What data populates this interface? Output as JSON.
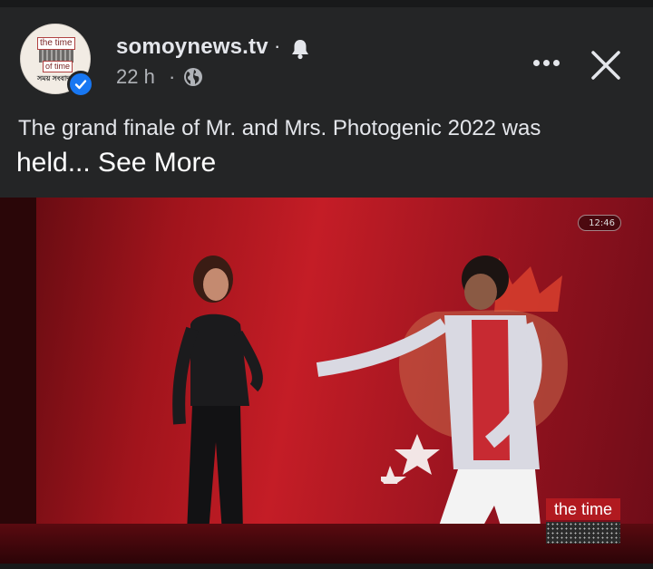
{
  "post": {
    "page_name": "somoynews.tv",
    "name_separator": "·",
    "time": "22 h",
    "time_separator": "·",
    "caption_line1": "The grand finale of Mr. and Mrs. Photogenic 2022 was",
    "caption_line2": "held... See More"
  },
  "avatar": {
    "logo_line1": "the time",
    "logo_line2": "of time",
    "logo_line3": "সময় সংবাদ"
  },
  "video": {
    "timestamp": "12:46",
    "watermark": "the time"
  },
  "icons": {
    "verified": "verified-badge-icon",
    "bell": "bell-icon",
    "globe": "globe-icon",
    "more": "more-options-icon",
    "close": "close-icon"
  },
  "colors": {
    "background": "#242526",
    "verified_blue": "#1877f2",
    "text_primary": "#e4e6eb",
    "text_secondary": "#b0b3b8",
    "video_red": "#c41d26"
  }
}
